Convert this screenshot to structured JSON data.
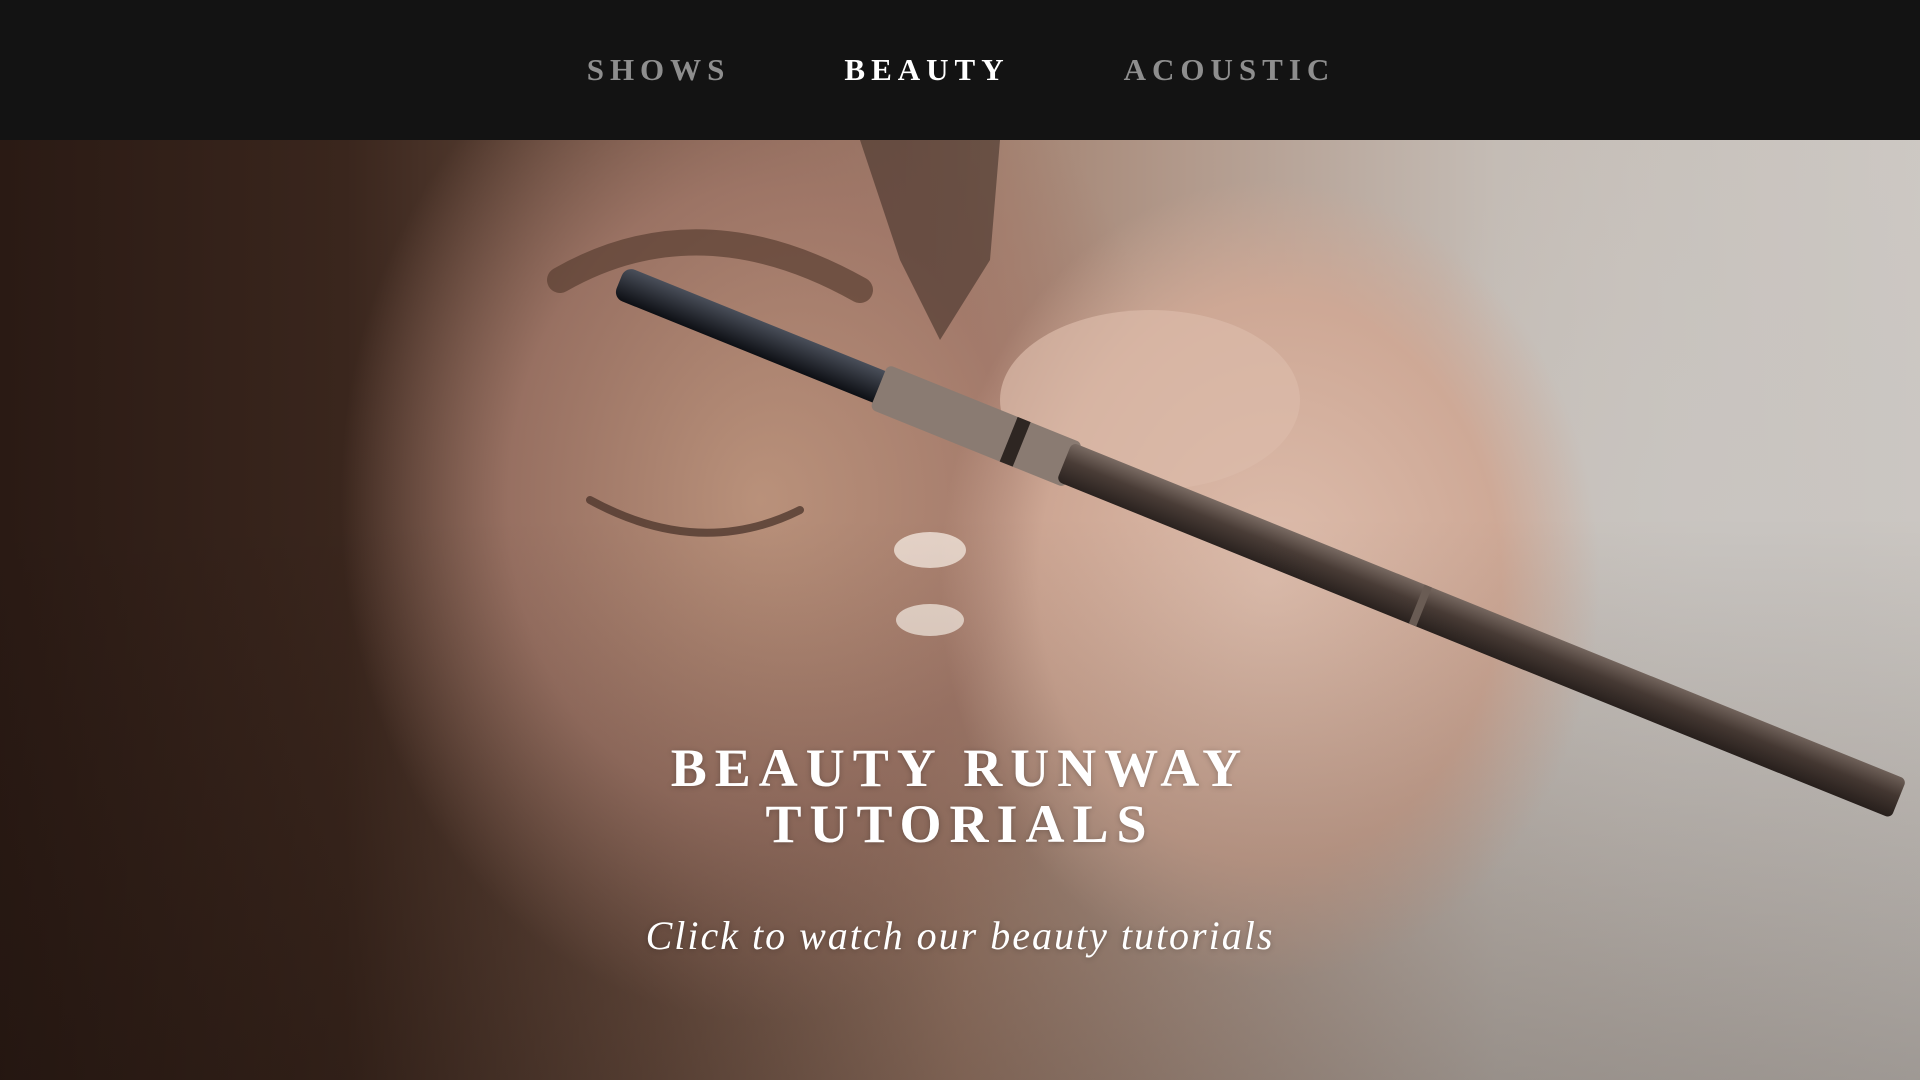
{
  "nav": {
    "items": [
      {
        "label": "SHOWS",
        "active": false
      },
      {
        "label": "BEAUTY",
        "active": true
      },
      {
        "label": "ACOUSTIC",
        "active": false
      }
    ]
  },
  "hero": {
    "title": "BEAUTY RUNWAY TUTORIALS",
    "cta": "Click to watch our beauty tutorials"
  },
  "colors": {
    "nav_background": "#131313",
    "nav_active": "#ffffff",
    "nav_inactive": "#8e8e8e"
  }
}
